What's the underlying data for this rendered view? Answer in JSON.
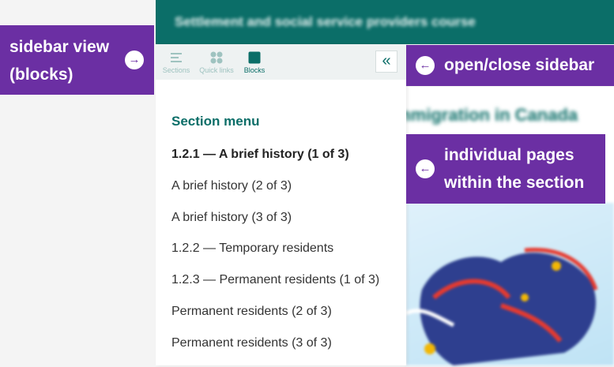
{
  "header": {
    "title": "Settlement and social service providers course"
  },
  "background": {
    "heading": "Immigration in Canada"
  },
  "tabs": [
    {
      "label": "Sections",
      "icon": "sections-icon"
    },
    {
      "label": "Quick links",
      "icon": "quick-links-icon"
    },
    {
      "label": "Blocks",
      "icon": "blocks-icon"
    }
  ],
  "collapse_button": {
    "glyph": "«"
  },
  "section_menu": {
    "title": "Section menu",
    "items": [
      "1.2.1 — A brief history (1 of 3)",
      "A brief history (2 of 3)",
      "A brief history (3 of 3)",
      "1.2.2 — Temporary residents",
      "1.2.3 — Permanent residents (1 of 3)",
      "Permanent residents (2 of 3)",
      "Permanent residents (3 of 3)"
    ]
  },
  "callouts": {
    "sidebar_view": {
      "line1": "sidebar view",
      "line2": "(blocks)",
      "arrow": "→"
    },
    "open_close": {
      "line1": "open/close sidebar",
      "arrow": "←"
    },
    "individual_pages": {
      "line1": "individual pages",
      "line2": "within the section",
      "arrow": "←"
    }
  },
  "colors": {
    "accent": "#0b6e68",
    "callout": "#6b2fa3"
  }
}
